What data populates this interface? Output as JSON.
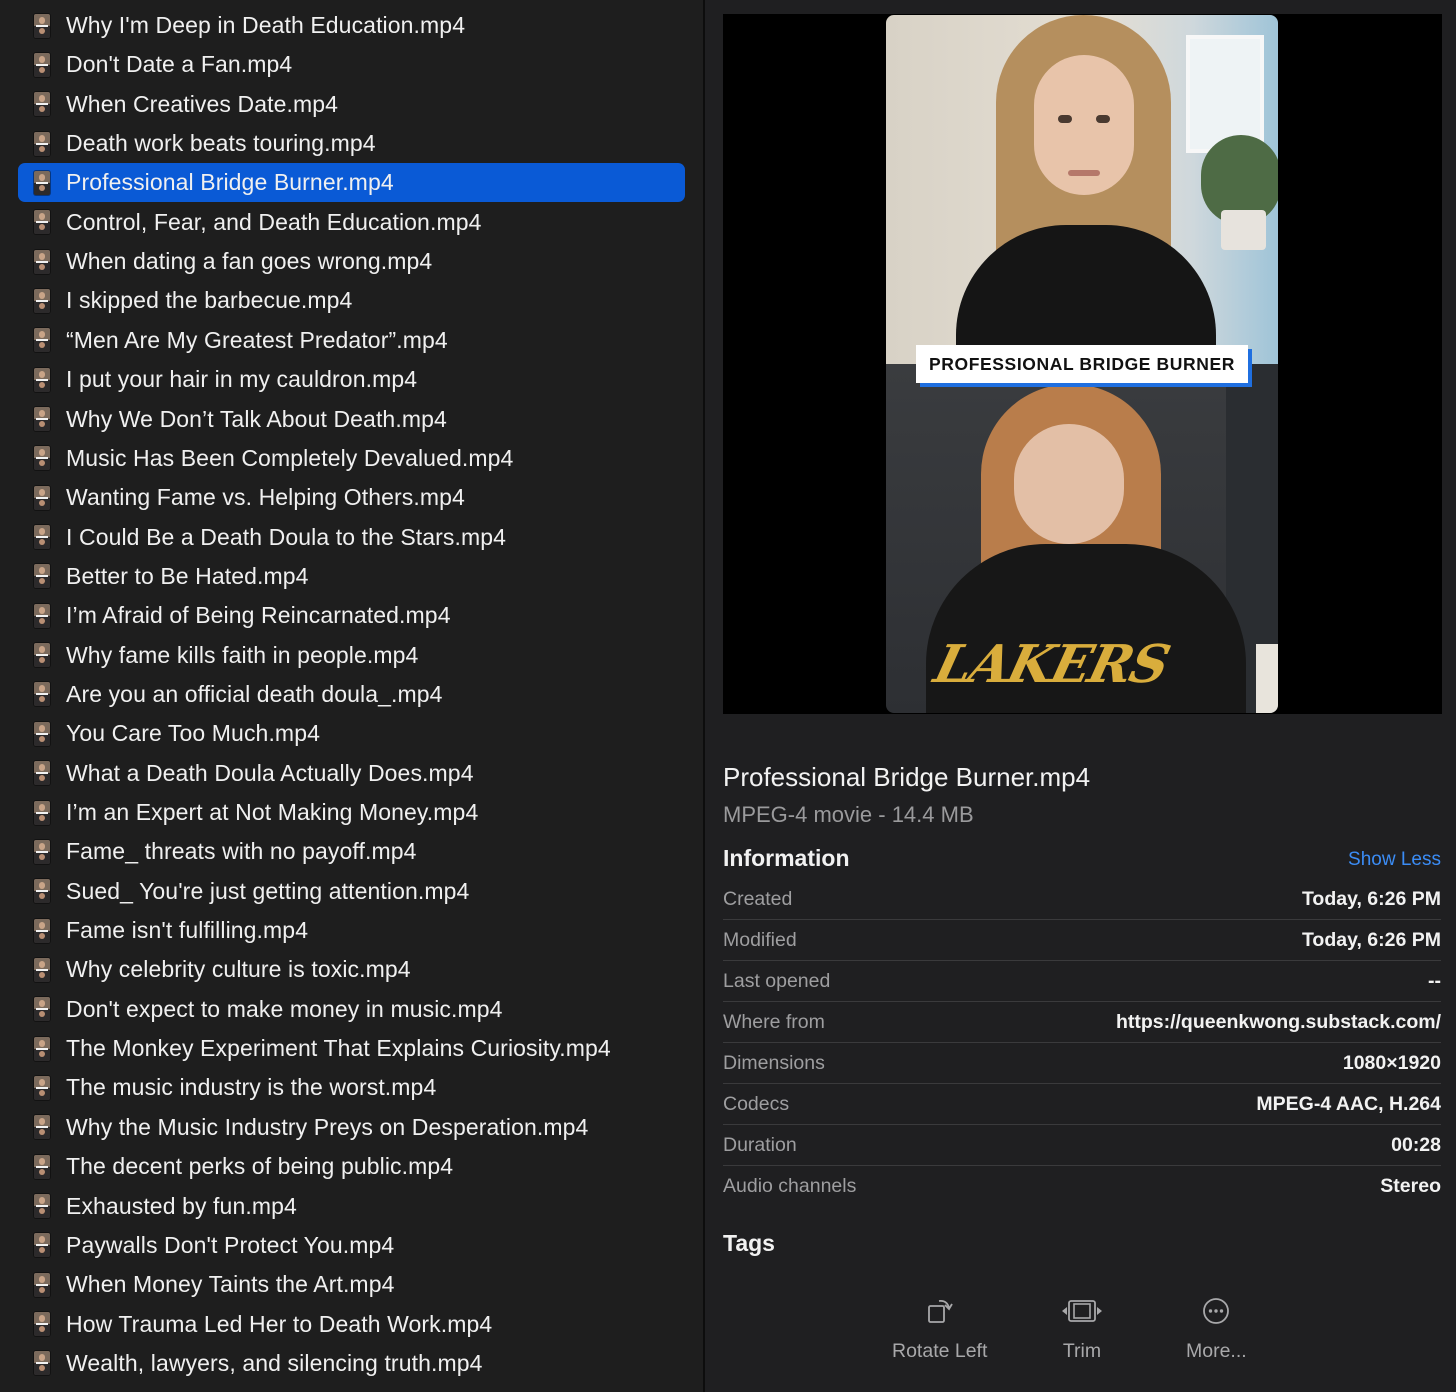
{
  "files": [
    {
      "name": "Why I'm Deep in Death Education.mp4"
    },
    {
      "name": "Don't Date a Fan.mp4"
    },
    {
      "name": "When Creatives Date.mp4"
    },
    {
      "name": "Death work beats touring.mp4"
    },
    {
      "name": "Professional Bridge Burner.mp4",
      "selected": true
    },
    {
      "name": "Control, Fear, and Death Education.mp4"
    },
    {
      "name": "When dating a fan goes wrong.mp4"
    },
    {
      "name": "I skipped the barbecue.mp4"
    },
    {
      "name": "“Men Are My Greatest Predator”.mp4"
    },
    {
      "name": "I put your hair in my cauldron.mp4"
    },
    {
      "name": "Why We Don’t Talk About Death.mp4"
    },
    {
      "name": "Music Has Been Completely Devalued.mp4"
    },
    {
      "name": "Wanting Fame vs. Helping Others.mp4"
    },
    {
      "name": "I Could Be a Death Doula to the Stars.mp4"
    },
    {
      "name": "Better to Be Hated.mp4"
    },
    {
      "name": "I’m Afraid of Being Reincarnated.mp4"
    },
    {
      "name": "Why fame kills faith in people.mp4"
    },
    {
      "name": "Are you an official death doula_.mp4"
    },
    {
      "name": "You Care Too Much.mp4"
    },
    {
      "name": "What a Death Doula Actually Does.mp4"
    },
    {
      "name": "I’m an Expert at Not Making Money.mp4"
    },
    {
      "name": "Fame_ threats with no payoff.mp4"
    },
    {
      "name": "Sued_ You're just getting attention.mp4"
    },
    {
      "name": "Fame isn't fulfilling.mp4"
    },
    {
      "name": "Why celebrity culture is toxic.mp4"
    },
    {
      "name": "Don't expect to make money in music.mp4"
    },
    {
      "name": "The Monkey Experiment That Explains Curiosity.mp4"
    },
    {
      "name": "The music industry is the worst.mp4"
    },
    {
      "name": "Why the Music Industry Preys on Desperation.mp4"
    },
    {
      "name": "The decent perks of being public.mp4"
    },
    {
      "name": "Exhausted by fun.mp4"
    },
    {
      "name": "Paywalls Don't Protect You.mp4"
    },
    {
      "name": "When Money Taints the Art.mp4"
    },
    {
      "name": "How Trauma Led Her to Death Work.mp4"
    },
    {
      "name": "Wealth, lawyers, and silencing truth.mp4"
    }
  ],
  "preview": {
    "caption": "PROFESSIONAL BRIDGE BURNER",
    "shirt_text": "LAKERS"
  },
  "inspector": {
    "title": "Professional Bridge Burner.mp4",
    "subtitle": "MPEG-4 movie - 14.4 MB",
    "info_heading": "Information",
    "show_less": "Show Less",
    "info": [
      {
        "label": "Created",
        "value": "Today, 6:26 PM"
      },
      {
        "label": "Modified",
        "value": "Today, 6:26 PM"
      },
      {
        "label": "Last opened",
        "value": "--"
      },
      {
        "label": "Where from",
        "value": "https://queenkwong.substack.com/"
      },
      {
        "label": "Dimensions",
        "value": "1080×1920"
      },
      {
        "label": "Codecs",
        "value": "MPEG-4 AAC, H.264"
      },
      {
        "label": "Duration",
        "value": "00:28"
      },
      {
        "label": "Audio channels",
        "value": "Stereo"
      }
    ],
    "tags_heading": "Tags"
  },
  "actions": {
    "rotate_left": {
      "label": "Rotate Left",
      "icon": "rotate-left-icon"
    },
    "trim": {
      "label": "Trim",
      "icon": "trim-icon"
    },
    "more": {
      "label": "More...",
      "icon": "more-icon"
    }
  },
  "colors": {
    "selection": "#0a5ad6",
    "link": "#3b8cf5",
    "background": "#1e1e1e"
  }
}
